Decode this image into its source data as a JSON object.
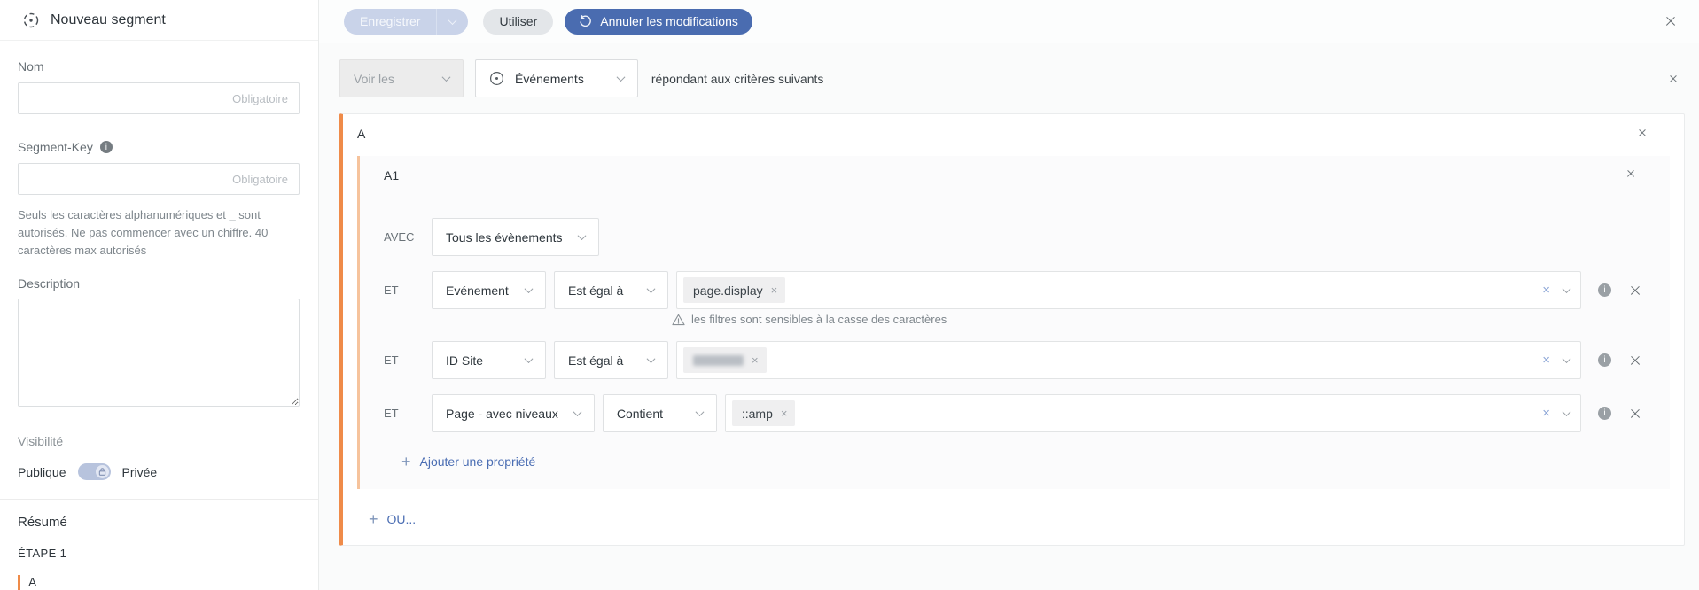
{
  "sidebar": {
    "title": "Nouveau segment",
    "fields": {
      "name_label": "Nom",
      "name_value": "",
      "name_placeholder": "Obligatoire",
      "segment_key_label": "Segment-Key",
      "segment_key_value": "",
      "segment_key_placeholder": "Obligatoire",
      "segment_key_help_line1": "Seuls les caractères alphanumériques et _ sont autorisés.",
      "segment_key_help_line2": "Ne pas commencer avec un chiffre. 40 caractères max autorisés",
      "description_label": "Description",
      "description_value": ""
    },
    "visibility": {
      "label": "Visibilité",
      "option_public": "Publique",
      "option_private": "Privée",
      "selected": "Privée"
    },
    "summary": {
      "title": "Résumé",
      "step_label": "ÉTAPE 1",
      "items": [
        "A"
      ]
    }
  },
  "toolbar": {
    "save_label": "Enregistrer",
    "save_enabled": false,
    "use_label": "Utiliser",
    "cancel_label": "Annuler les modifications"
  },
  "scope": {
    "view_select_value": "Voir les",
    "view_select_disabled": true,
    "entity_select_value": "Événements",
    "suffix_text": "répondant aux critères suivants"
  },
  "builder": {
    "group_label": "A",
    "subgroup_label": "A1",
    "with_label": "AVEC",
    "with_value": "Tous les évènements",
    "rows": [
      {
        "connector": "ET",
        "property": "Evénement",
        "operator": "Est égal à",
        "chips": [
          {
            "text": "page.display",
            "redacted": false
          }
        ],
        "warning": "les filtres sont sensibles à la casse des caractères"
      },
      {
        "connector": "ET",
        "property": "ID Site",
        "operator": "Est égal à",
        "chips": [
          {
            "text": "",
            "redacted": true
          }
        ],
        "warning": null
      },
      {
        "connector": "ET",
        "property": "Page - avec niveaux",
        "operator": "Contient",
        "chips": [
          {
            "text": "::amp",
            "redacted": false
          }
        ],
        "warning": null
      }
    ],
    "add_property_label": "Ajouter une propriété",
    "add_or_label": "OU..."
  },
  "colors": {
    "accent_orange": "#ef8b49",
    "accent_orange_light": "#f6c39c",
    "primary_blue": "#4a6cb0",
    "link_blue": "#4a6db3",
    "disabled_button_bg": "#c9d3e9",
    "toggle_track": "#b7c3dd",
    "chip_bg": "#efeff0"
  },
  "icons": {
    "sidebar_header": "segment-target-icon (dashed circle with center dot)",
    "segment_key": "info-icon",
    "toggle_knob": "lock-icon",
    "save_caret": "chevron-down-icon",
    "cancel": "undo-icon",
    "entity_select": "target-icon (circle with center dot)",
    "row_warning": "warning-triangle-icon",
    "chip_remove": "×",
    "field_clear": "✕",
    "close": "✕",
    "add": "+"
  }
}
